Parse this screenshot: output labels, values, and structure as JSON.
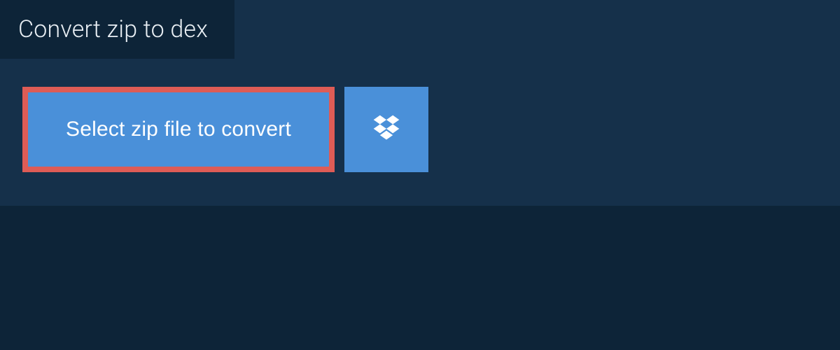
{
  "header": {
    "title": "Convert zip to dex"
  },
  "actions": {
    "select_file_label": "Select zip file to convert"
  },
  "colors": {
    "page_bg": "#0d2438",
    "panel_bg": "#15304a",
    "button_bg": "#4a90d9",
    "highlight_border": "#de5c56",
    "text_light": "#e8eef3"
  }
}
